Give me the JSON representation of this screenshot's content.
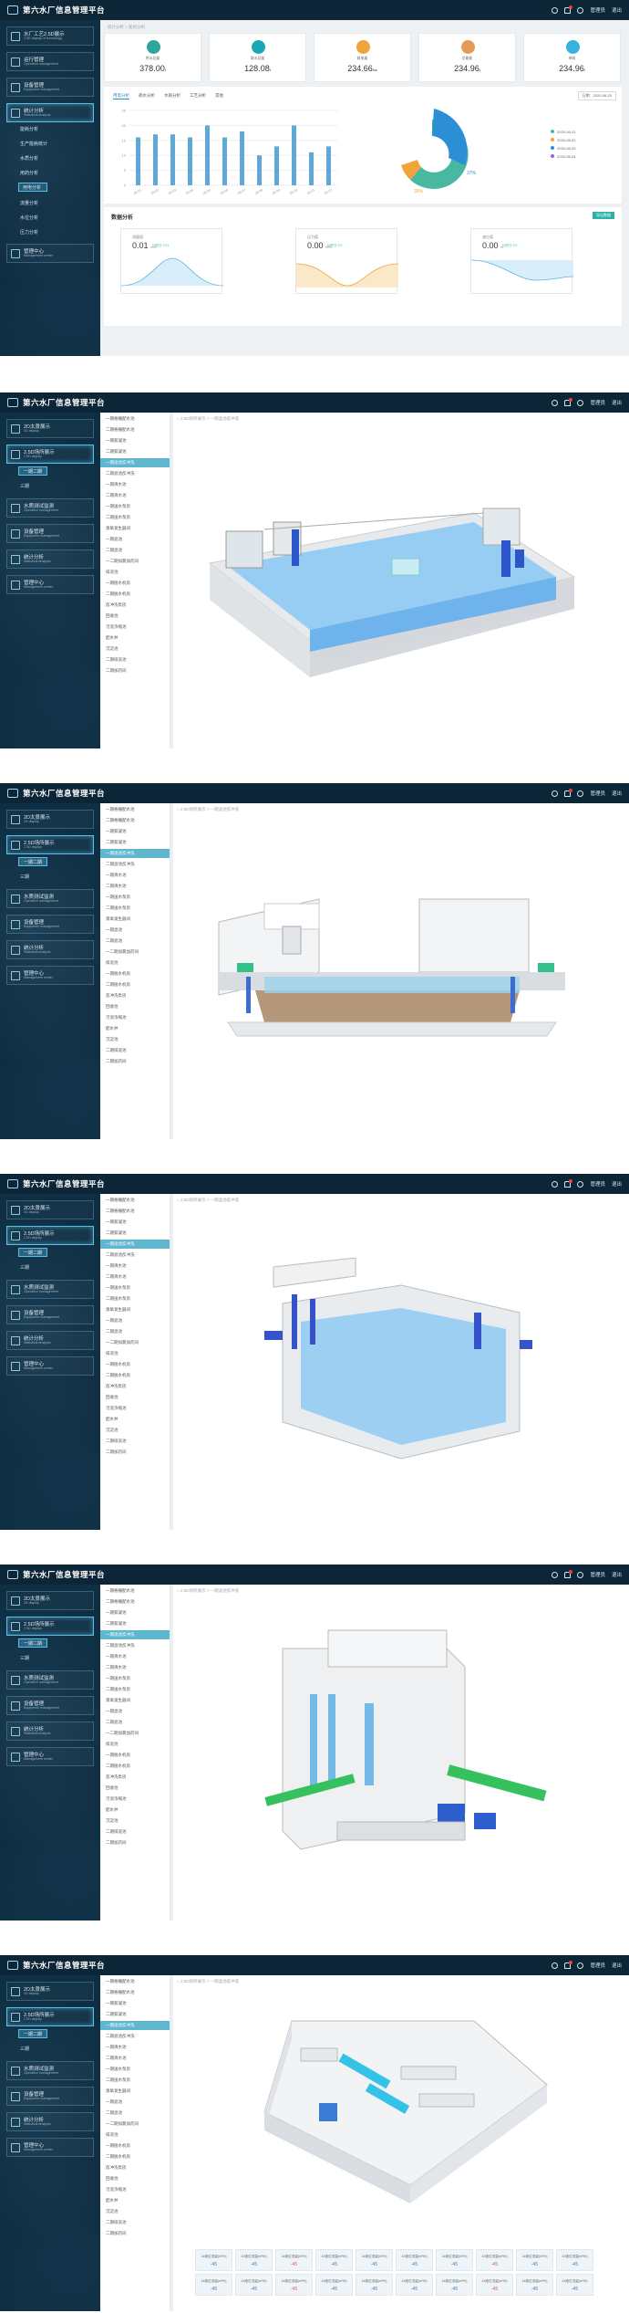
{
  "app": {
    "title": "第六水厂信息管理平台",
    "user": "管理员",
    "logout": "退出"
  },
  "screens": [
    {
      "menu": [
        {
          "cn": "水厂工艺2.5D展示",
          "en": "2.5D display of technology"
        },
        {
          "cn": "运行管理",
          "en": "Operation management"
        },
        {
          "cn": "设备管理",
          "en": "Equipment management"
        },
        {
          "cn": "统计分析",
          "en": "Statistical analysis"
        },
        {
          "cn": "管理中心",
          "en": "Management center"
        }
      ],
      "subs": [
        "能耗分析",
        "生产能耗统计",
        "水质分析",
        "用药分析",
        "用电分析",
        "流量分析",
        "水位分析",
        "压力分析",
        "报表管理"
      ],
      "breadcrumb": "统计分析 > 能耗分析",
      "cards": [
        {
          "label": "供水总量",
          "value": "378.00",
          "unit": "t",
          "color": "#2fa59b"
        },
        {
          "label": "取水总量",
          "value": "128.08",
          "unit": "t",
          "color": "#1aa7b8"
        },
        {
          "label": "耗电量",
          "value": "234.66",
          "unit": "kw",
          "color": "#f0a43a"
        },
        {
          "label": "总能耗",
          "value": "234.96",
          "unit": "t",
          "color": "#e59b57"
        },
        {
          "label": "单耗",
          "value": "234.96",
          "unit": "t",
          "color": "#36b2de"
        }
      ],
      "tabs": [
        "用电分析",
        "耗水分析",
        "水质分析",
        "工艺分析",
        "其他"
      ],
      "date_select": "日期：2020-06-20",
      "legend": [
        "2020-06-01",
        "2020-06-02",
        "2020-06-03",
        "2020-06-04"
      ],
      "pie_pct": [
        "37%",
        "35%"
      ],
      "section": "数据分析",
      "export": "导出数据",
      "minis": [
        {
          "label": "流量值",
          "value": "0.01",
          "unit": "m³/h",
          "change": "比昨日 0.01"
        },
        {
          "label": "压力值",
          "value": "0.00",
          "unit": "MPa",
          "change": "比昨日 0.0"
        },
        {
          "label": "液位值",
          "value": "0.00",
          "unit": "m",
          "change": "比昨日 0.0"
        }
      ]
    },
    {
      "menu": [
        {
          "cn": "2D太景展示",
          "en": "2D display"
        },
        {
          "cn": "2.5D场所展示",
          "en": "2.5D display"
        },
        {
          "cn": "水质测试监测",
          "en": "Operation management"
        },
        {
          "cn": "设备管理",
          "en": "Equipment management"
        },
        {
          "cn": "统计分析",
          "en": "Statistical analysis"
        },
        {
          "cn": "管理中心",
          "en": "Management center"
        }
      ],
      "active_sub": "一期二期",
      "plain_sub": "三期"
    }
  ],
  "menu2": [
    "一期格栅配水池",
    "二期格栅配水池",
    "一期絮凝池",
    "二期絮凝池",
    "一期滤池反冲洗",
    "二期滤池反冲洗",
    "一期清水池",
    "二期清水池",
    "一期送水泵房",
    "二期送水泵房",
    "臭氧发生器间",
    "一期滤池",
    "二期滤池",
    "一二期加氯加药间",
    "排泥池",
    "一期脱水机房",
    "二期脱水机房",
    "反冲洗泵房",
    "回收池",
    "污泥浓缩池",
    "配水井",
    "沉淀池",
    "二期排泥池",
    "二期加药间"
  ],
  "flow": {
    "label": "1#液位流量(m³/h)",
    "values": [
      "-45",
      "-45",
      "-45",
      "-45",
      "-45",
      "-45",
      "-45",
      "-45",
      "-45",
      "-45",
      "-45",
      "-45",
      "-45",
      "-45",
      "-45",
      "-45",
      "-45",
      "-45",
      "-45",
      "-45"
    ]
  },
  "chart_data": {
    "type": "bar",
    "categories": [
      "06-01",
      "06-02",
      "06-03",
      "06-04",
      "06-05",
      "06-06",
      "06-07",
      "06-08",
      "06-09",
      "06-10",
      "06-11",
      "06-12"
    ],
    "values": [
      16,
      17,
      17,
      16,
      20,
      16,
      18,
      10,
      13,
      20,
      11,
      13
    ],
    "ylim": [
      0,
      25
    ],
    "xlabel": "",
    "ylabel": ""
  }
}
